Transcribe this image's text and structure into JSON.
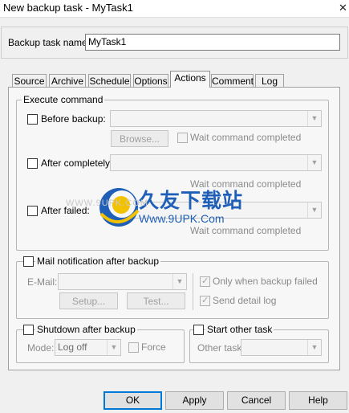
{
  "window": {
    "title": "New backup task - MyTask1",
    "close_glyph": "✕"
  },
  "task_name": {
    "label": "Backup task name:",
    "value": "MyTask1"
  },
  "tabs": [
    {
      "label": "Source"
    },
    {
      "label": "Archive"
    },
    {
      "label": "Schedule"
    },
    {
      "label": "Options"
    },
    {
      "label": "Actions",
      "active": true
    },
    {
      "label": "Comment"
    },
    {
      "label": "Log"
    }
  ],
  "execute": {
    "caption": "Execute command",
    "before_label": "Before backup:",
    "browse_label": "Browse...",
    "wait_label": "Wait command completed",
    "after_label": "After completely:",
    "after_wait_label": "Wait command completed",
    "failed_label": "After failed:",
    "failed_wait_label": "Wait command completed"
  },
  "mail": {
    "caption": "Mail notification after backup",
    "email_label": "E-Mail:",
    "setup_label": "Setup...",
    "test_label": "Test...",
    "only_failed_label": "Only when backup failed",
    "send_log_label": "Send detail log"
  },
  "shutdown": {
    "caption": "Shutdown after backup",
    "mode_label": "Mode:",
    "mode_value": "Log off",
    "force_label": "Force"
  },
  "other_task": {
    "caption": "Start other task",
    "label": "Other task:"
  },
  "buttons": {
    "ok": "OK",
    "apply": "Apply",
    "cancel": "Cancel",
    "help": "Help"
  },
  "watermark": {
    "brand": "久友下载站",
    "url": "Www.9UPK.Com",
    "faint": "WWW.9UPK.COM"
  },
  "colors": {
    "watermark_blue": "#1f5fb8",
    "focus_blue": "#0078d7"
  }
}
